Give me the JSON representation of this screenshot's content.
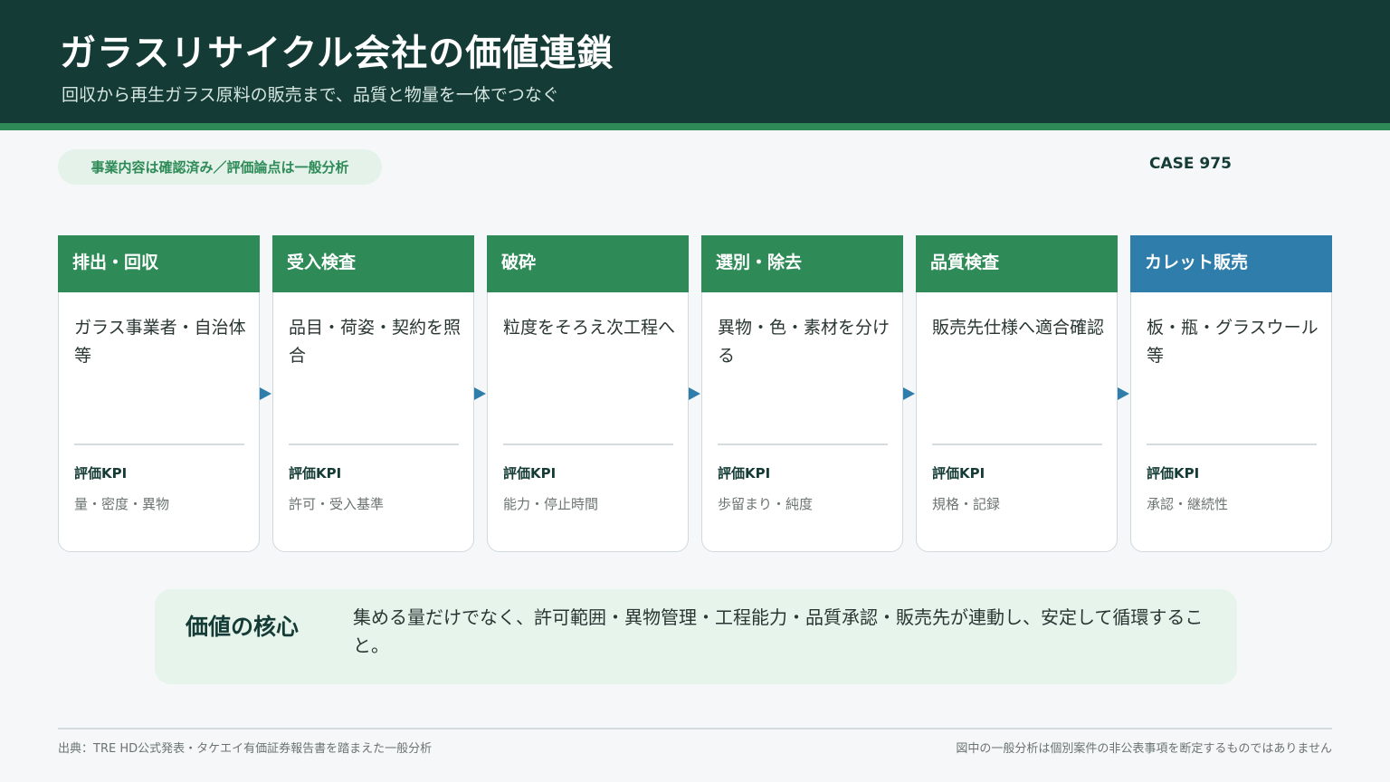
{
  "header": {
    "title": "ガラスリサイクル会社の価値連鎖",
    "subtitle": "回収から再生ガラス原料の販売まで、品質と物量を一体でつなぐ"
  },
  "badge": "事業内容は確認済み／評価論点は一般分析",
  "case_id": "CASE 975",
  "kpi_label": "評価KPI",
  "steps": [
    {
      "title": "排出・回収",
      "desc": "ガラス事業者・自治体等",
      "kpi": "量・密度・異物"
    },
    {
      "title": "受入検査",
      "desc": "品目・荷姿・契約を照合",
      "kpi": "許可・受入基準"
    },
    {
      "title": "破砕",
      "desc": "粒度をそろえ次工程へ",
      "kpi": "能力・停止時間"
    },
    {
      "title": "選別・除去",
      "desc": "異物・色・素材を分ける",
      "kpi": "歩留まり・純度"
    },
    {
      "title": "品質検査",
      "desc": "販売先仕様へ適合確認",
      "kpi": "規格・記録"
    },
    {
      "title": "カレット販売",
      "desc": "板・瓶・グラスウール等",
      "kpi": "承認・継続性"
    }
  ],
  "core": {
    "label": "価値の核心",
    "text": "集める量だけでなく、許可範囲・異物管理・工程能力・品質承認・販売先が連動し、安定して循環すること。"
  },
  "footer": {
    "source": "出典：TRE HD公式発表・タケエイ有価証券報告書を踏まえた一般分析",
    "disclaimer": "図中の一般分析は個別案件の非公表事項を断定するものではありません"
  },
  "colors": {
    "header_bg": "#143b35",
    "accent_green": "#2e8b57",
    "accent_blue": "#2f7daa",
    "core_bg": "#e6f4ec"
  }
}
